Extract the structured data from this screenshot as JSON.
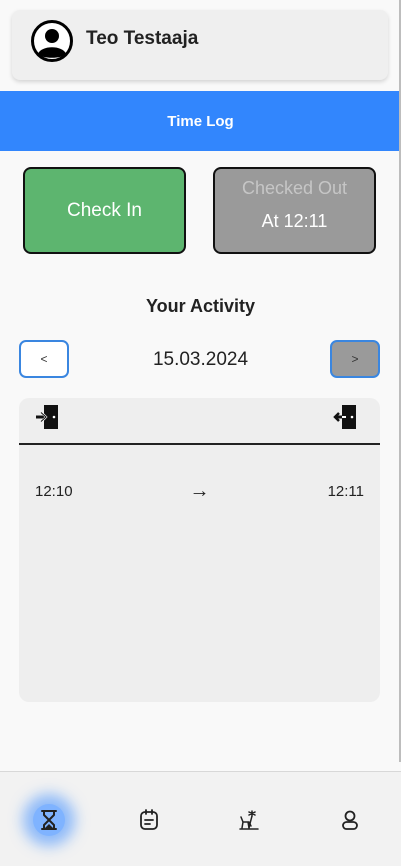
{
  "user": {
    "name": "Teo Testaaja",
    "avatar_icon": "user-circle-icon"
  },
  "header": {
    "title": "Time Log"
  },
  "actions": {
    "check_in_label": "Check In",
    "checked_out_label": "Checked Out",
    "checked_out_time": "At 12:11"
  },
  "activity": {
    "title": "Your Activity",
    "prev_label": "<",
    "next_label": ">",
    "date": "15.03.2024",
    "check_in_icon": "door-enter-icon",
    "check_out_icon": "door-exit-icon",
    "entries": [
      {
        "in": "12:10",
        "arrow": "→",
        "out": "12:11"
      }
    ]
  },
  "bottom_nav": {
    "items": [
      {
        "icon": "hourglass-icon",
        "active": true
      },
      {
        "icon": "calendar-note-icon",
        "active": false
      },
      {
        "icon": "beach-holiday-icon",
        "active": false
      },
      {
        "icon": "profile-icon",
        "active": false
      }
    ]
  },
  "colors": {
    "header_bg": "#3286fd",
    "check_in_bg": "#5db56f",
    "checked_out_bg": "#9a9a9a",
    "active_glow": "#3c8cff"
  }
}
